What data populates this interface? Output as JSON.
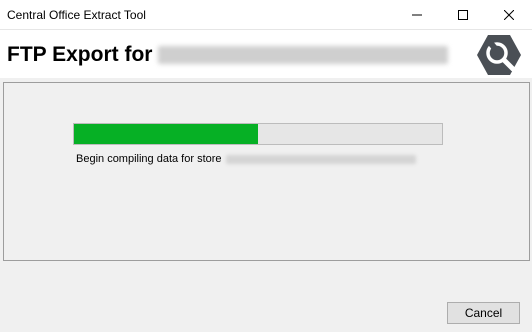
{
  "window": {
    "title": "Central Office Extract Tool",
    "controls": {
      "minimize": "minimize-icon",
      "maximize": "maximize-icon",
      "close": "close-icon"
    }
  },
  "header": {
    "heading": "FTP Export for",
    "logo_icon": "wrench-magnifier-logo-icon"
  },
  "progress": {
    "fraction": 0.5,
    "fill_color": "#06b025",
    "status_text": "Begin compiling data for store"
  },
  "footer": {
    "cancel_label": "Cancel"
  }
}
